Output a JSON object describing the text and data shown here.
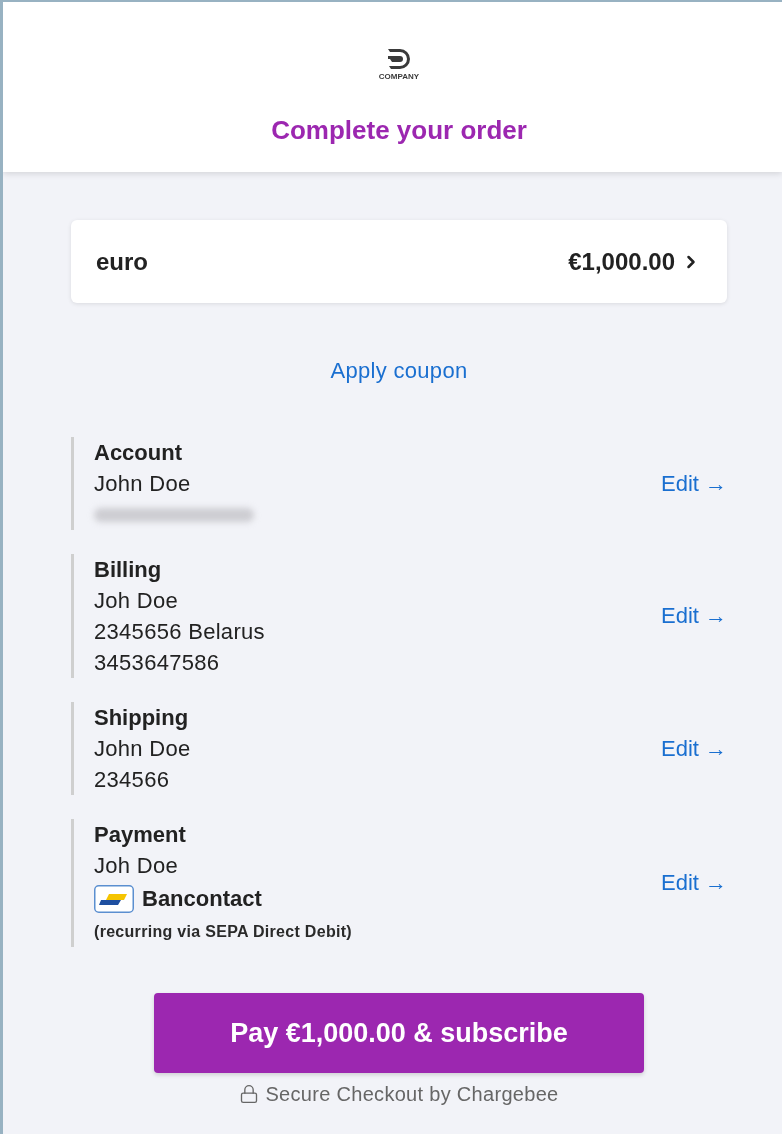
{
  "header": {
    "logo_text": "COMPANY",
    "title": "Complete your order"
  },
  "summary": {
    "label": "euro",
    "amount": "€1,000.00"
  },
  "coupon_link": "Apply coupon",
  "sections": [
    {
      "kind": "details",
      "heading": "Account",
      "lines": [
        "John Doe"
      ],
      "hidden_line": true,
      "edit": "Edit →"
    },
    {
      "kind": "details",
      "heading": "Billing",
      "lines": [
        "Joh Doe",
        "2345656 Belarus",
        "3453647586"
      ],
      "hidden_line": false,
      "edit": "Edit →"
    },
    {
      "kind": "details",
      "heading": "Shipping",
      "lines": [
        "John Doe",
        "234566"
      ],
      "hidden_line": false,
      "edit": "Edit →"
    },
    {
      "kind": "payment",
      "heading": "Payment",
      "lines": [
        "Joh Doe"
      ],
      "method": "Bancontact",
      "note": "(recurring via SEPA Direct Debit)",
      "edit": "Edit →"
    }
  ],
  "pay_button": "Pay €1,000.00 & subscribe",
  "footer": "Secure Checkout by Chargebee"
}
